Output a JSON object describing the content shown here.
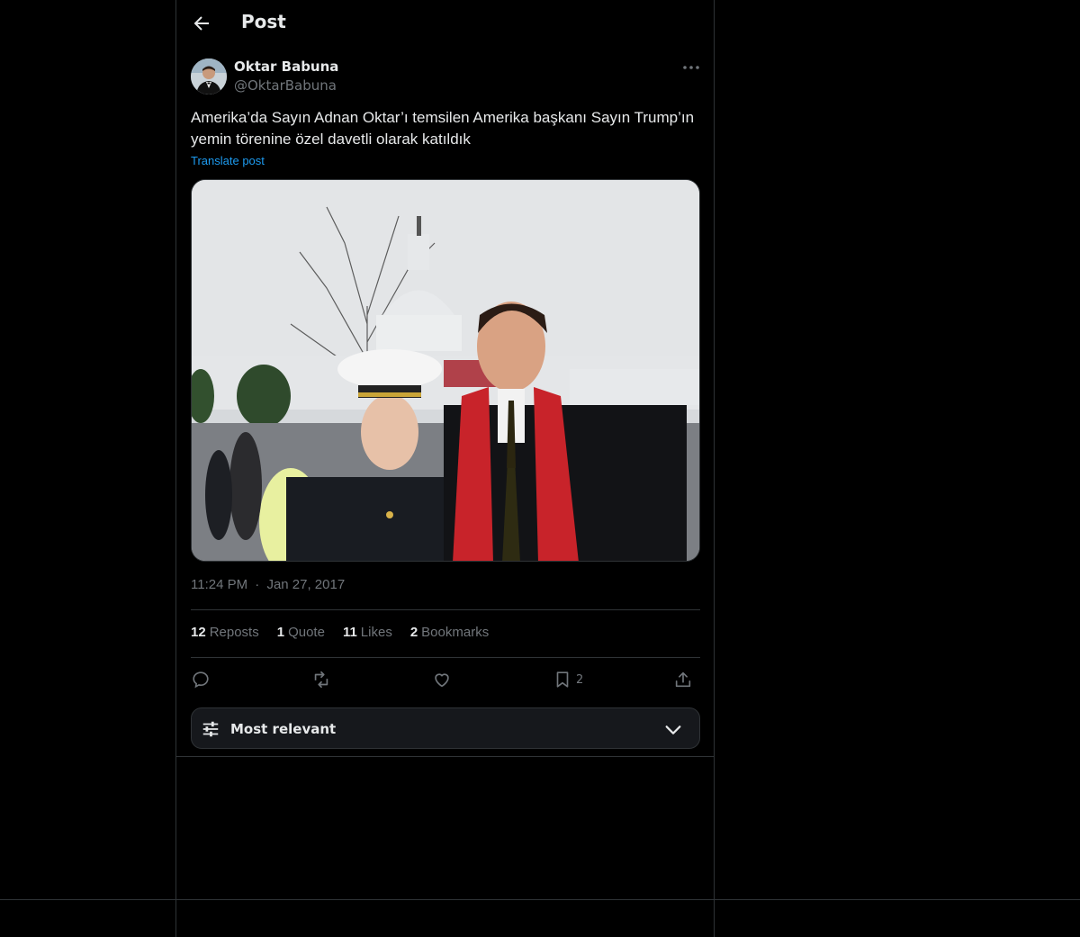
{
  "header": {
    "title": "Post"
  },
  "post": {
    "author_name": "Oktar Babuna",
    "author_handle": "@OktarBabuna",
    "text": "Amerika’da Sayın Adnan Oktar’ı temsilen Amerika başkanı Sayın Trump’ın yemin törenine özel davetli olarak katıldık",
    "translate_label": "Translate post",
    "time": "11:24 PM",
    "separator": "·",
    "date": "Jan 27, 2017"
  },
  "stats": {
    "reposts_count": "12",
    "reposts_label": "Reposts",
    "quotes_count": "1",
    "quotes_label": "Quote",
    "likes_count": "11",
    "likes_label": "Likes",
    "bookmarks_count": "2",
    "bookmarks_label": "Bookmarks"
  },
  "actions": {
    "bookmark_count": "2"
  },
  "sort": {
    "label": "Most relevant"
  },
  "icons": [
    "back-arrow-icon",
    "more-icon",
    "reply-icon",
    "repost-icon",
    "like-icon",
    "bookmark-icon",
    "share-icon",
    "sliders-icon",
    "chevron-down-icon"
  ],
  "colors": {
    "background": "#000000",
    "text": "#e7e9ea",
    "muted": "#71767b",
    "link": "#1d9bf0",
    "border": "#2f3336"
  }
}
